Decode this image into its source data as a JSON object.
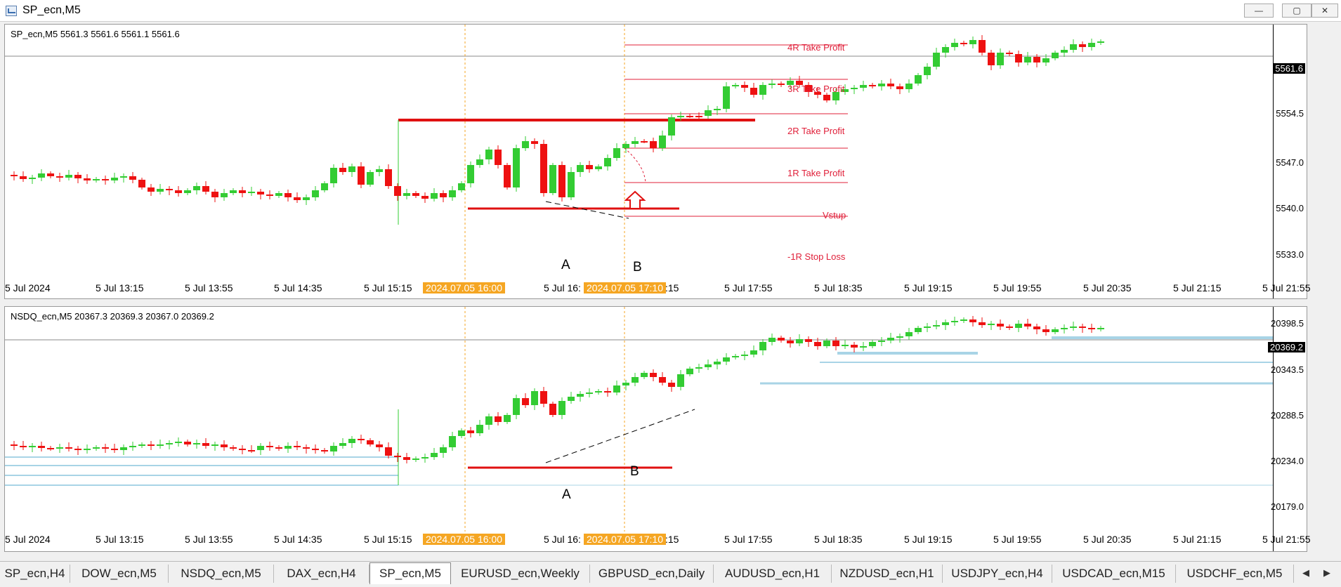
{
  "window": {
    "title": "SP_ecn,M5",
    "buttons": [
      "—",
      "▢",
      "✕"
    ]
  },
  "top_chart": {
    "header": "SP_ecn,M5  5561.3 5561.6 5561.1 5561.6",
    "current_price": "5561.6",
    "price_labels": [
      "5554.5",
      "5547.0",
      "5540.0",
      "5533.0"
    ],
    "time_labels": [
      "5 Jul 2024",
      "5 Jul 13:15",
      "5 Jul 13:55",
      "5 Jul 14:35",
      "5 Jul 15:15",
      "5 Jul 16:",
      ":15",
      "5 Jul 17:55",
      "5 Jul 18:35",
      "5 Jul 19:15",
      "5 Jul 19:55",
      "5 Jul 20:35",
      "5 Jul 21:15",
      "5 Jul 21:55"
    ],
    "highlight_1": "2024.07.05 16:00",
    "highlight_2": "2024.07.05 17:10",
    "levels": {
      "tp4": "4R Take Profit",
      "tp3": "3R Take Profit",
      "tp2": "2R Take Profit",
      "tp1": "1R Take Profit",
      "entry": "Vstup",
      "sl": "-1R Stop Loss"
    },
    "marker_a": "A",
    "marker_b": "B"
  },
  "bottom_chart": {
    "header": "NSDQ_ecn,M5  20367.3 20369.3 20367.0 20369.2",
    "current_price": "20369.2",
    "price_labels": [
      "20398.5",
      "20343.5",
      "20288.5",
      "20234.0",
      "20179.0"
    ],
    "time_labels": [
      "5 Jul 2024",
      "5 Jul 13:15",
      "5 Jul 13:55",
      "5 Jul 14:35",
      "5 Jul 15:15",
      "5 Jul 16:",
      ":15",
      "5 Jul 17:55",
      "5 Jul 18:35",
      "5 Jul 19:15",
      "5 Jul 19:55",
      "5 Jul 20:35",
      "5 Jul 21:15",
      "5 Jul 21:55"
    ],
    "highlight_1": "2024.07.05 16:00",
    "highlight_2": "2024.07.05 17:10",
    "marker_a": "A",
    "marker_b": "B"
  },
  "tabs": [
    "SP_ecn,H4",
    "DOW_ecn,M5",
    "NSDQ_ecn,M5",
    "DAX_ecn,H4",
    "SP_ecn,M5",
    "EURUSD_ecn,Weekly",
    "GBPUSD_ecn,Daily",
    "AUDUSD_ecn,H1",
    "NZDUSD_ecn,H1",
    "USDJPY_ecn,H4",
    "USDCAD_ecn,M15",
    "USDCHF_ecn,M5"
  ],
  "active_tab": "SP_ecn,M5",
  "colors": {
    "bull": "#33cc33",
    "bear": "#ee1111",
    "level": "#e0203a",
    "highlight": "#f5a623",
    "zone": "#a8d4e6"
  }
}
